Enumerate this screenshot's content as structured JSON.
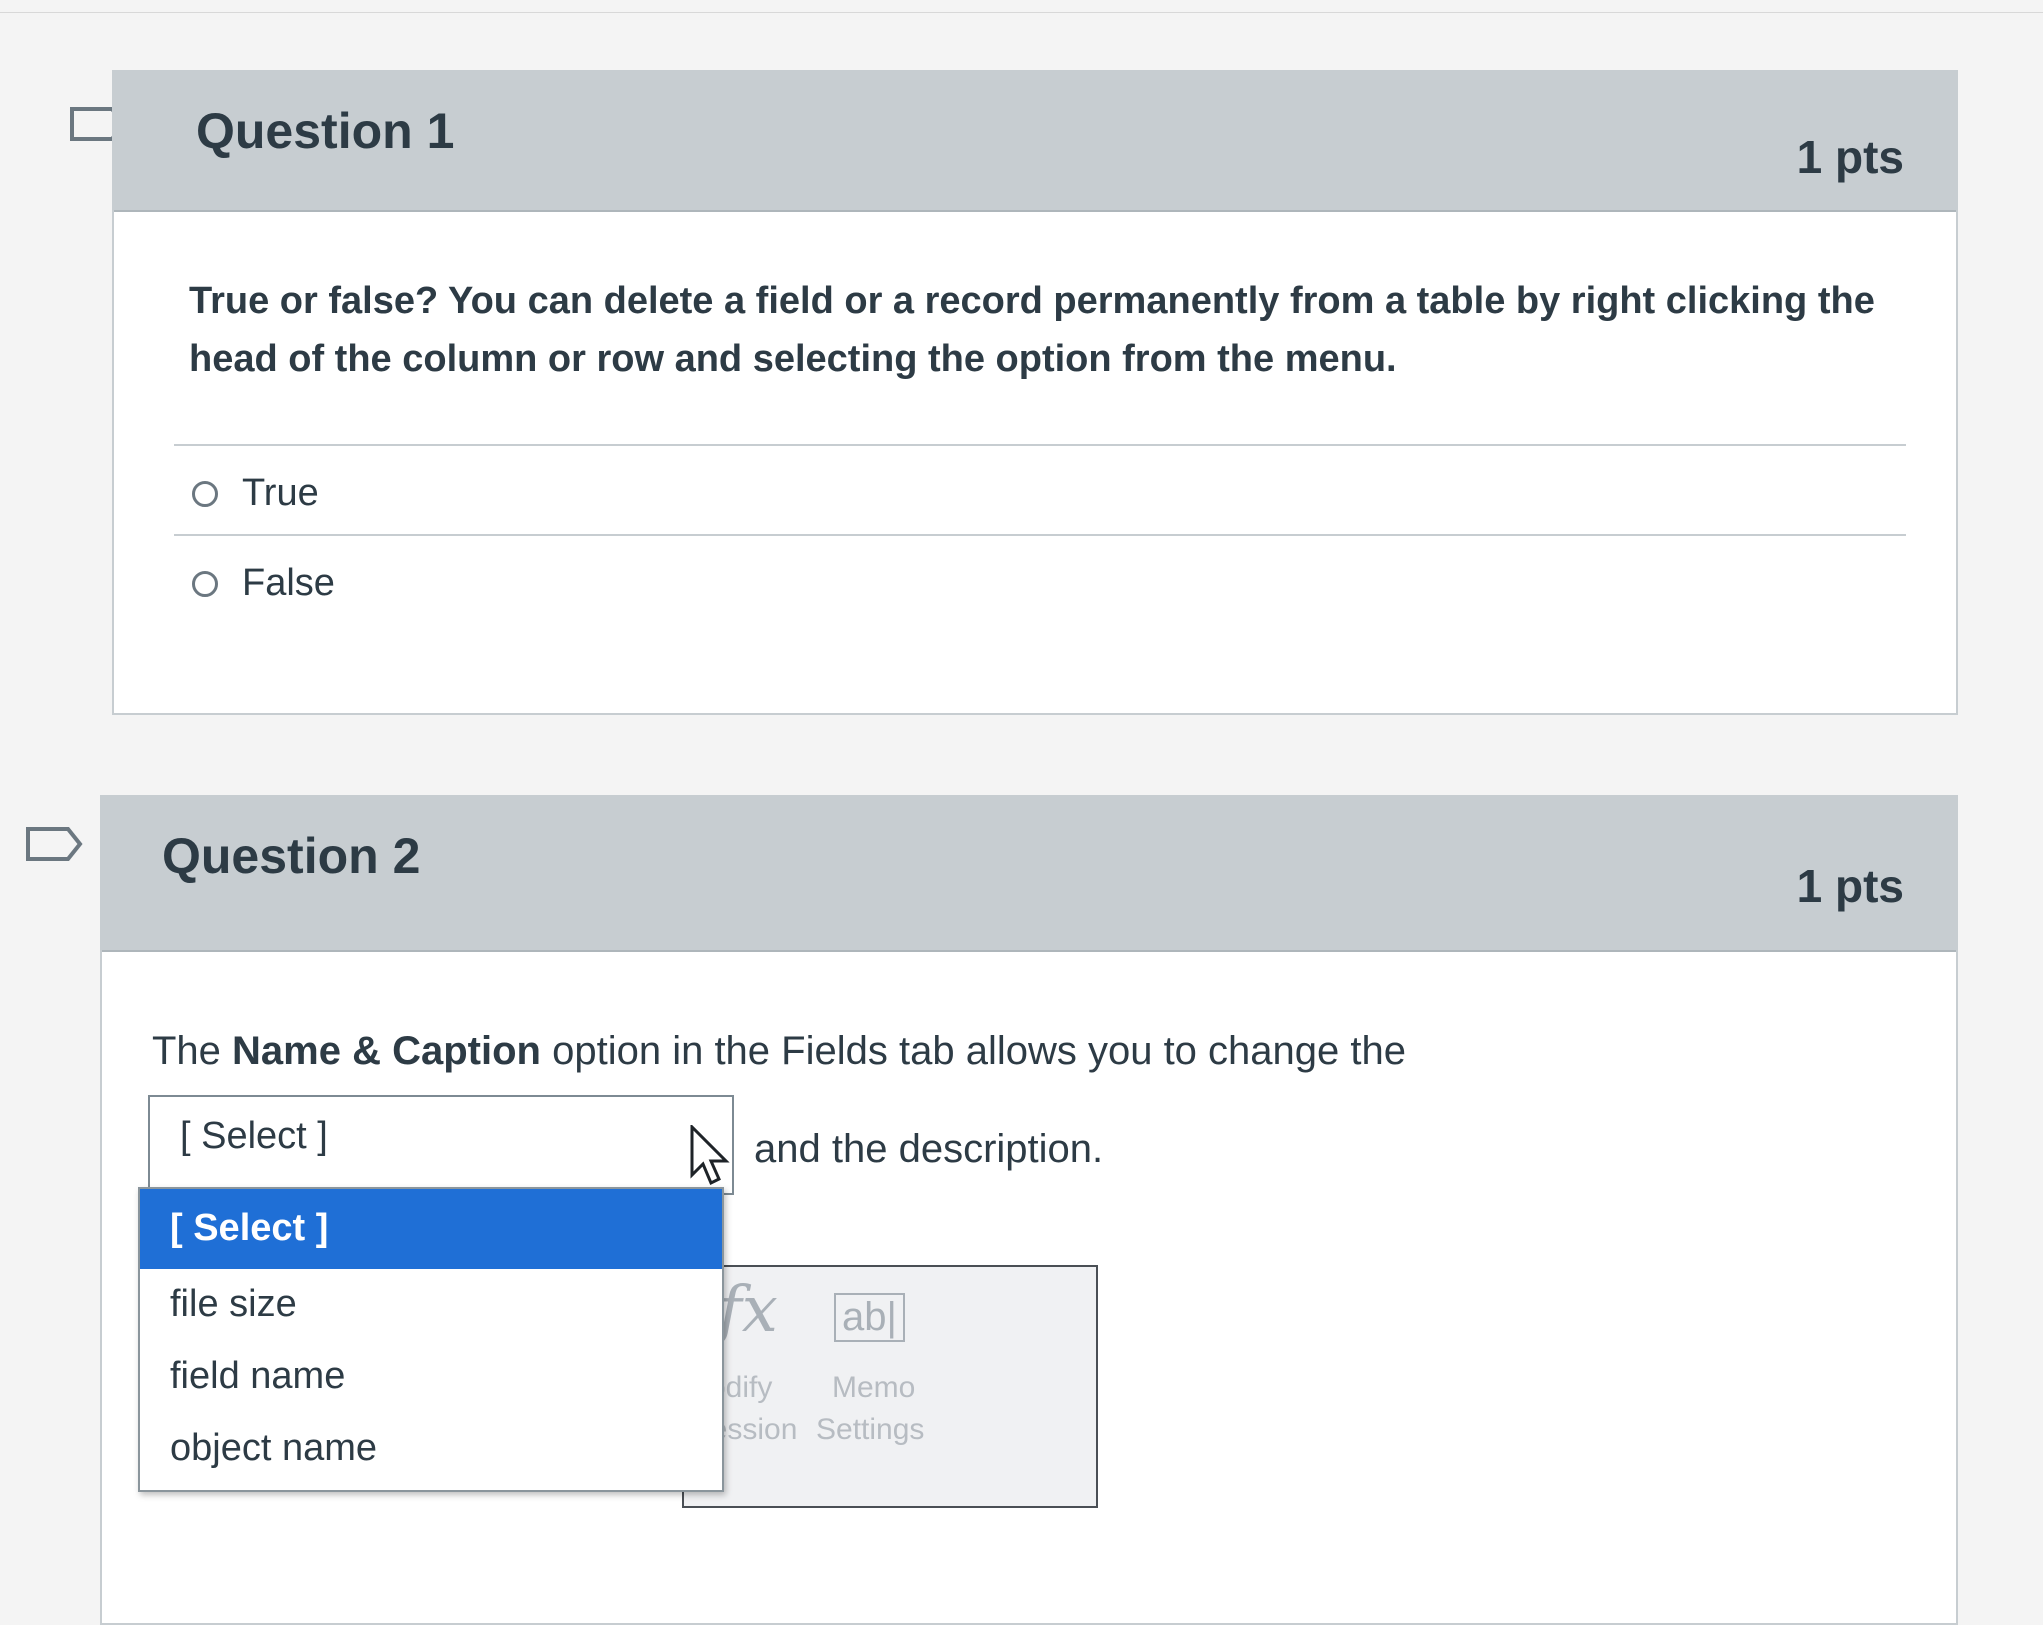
{
  "question1": {
    "title": "Question 1",
    "points": "1 pts",
    "text_line1": "True or false? You can delete a field or a record permanently from a table by right clicking the",
    "text_line2": "head of the column or row and selecting the option from the menu.",
    "answers": [
      "True",
      "False"
    ]
  },
  "question2": {
    "title": "Question 2",
    "points": "1 pts",
    "prompt_pre": "The ",
    "prompt_bold": "Name & Caption",
    "prompt_post": " option in the Fields tab allows you to change the",
    "after_select": "and the description.",
    "select_value": "[ Select ]",
    "options": [
      "[ Select ]",
      "file size",
      "field name",
      "object name"
    ],
    "selected_option_index": 0
  },
  "ribbon_fragment": {
    "fx_glyph": "fx",
    "memo_glyph": "ab|",
    "label_left_1": "Modify",
    "label_left_2": "pression",
    "label_right_1": "Memo",
    "label_right_2": "Settings"
  },
  "colors": {
    "header_bg": "#c7cdd1",
    "selected_option_bg": "#1f6fd6",
    "text": "#2d3b45"
  }
}
